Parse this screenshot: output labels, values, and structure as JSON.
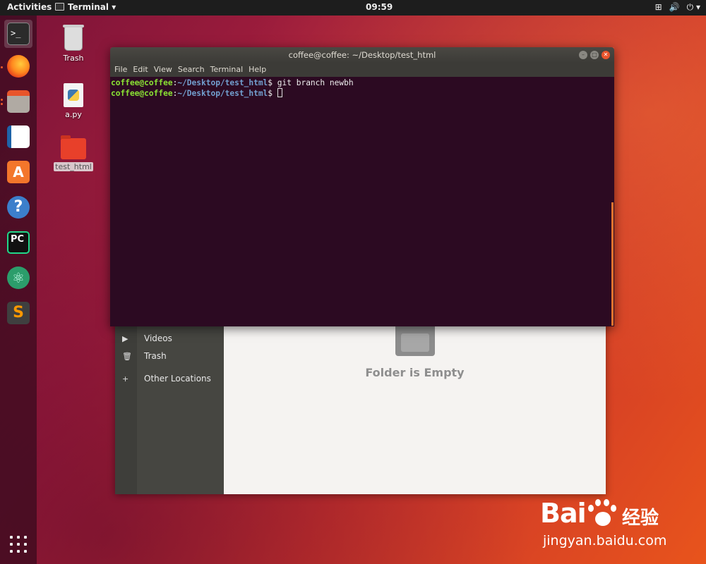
{
  "topbar": {
    "activities": "Activities",
    "app_menu": "Terminal ▾",
    "clock": "09:59",
    "tray": {
      "network": "⊞",
      "volume": "🔊",
      "power": "⏻ ▾"
    }
  },
  "dock": {
    "items": [
      {
        "name": "terminal",
        "glyph": ">_"
      },
      {
        "name": "firefox",
        "glyph": ""
      },
      {
        "name": "files",
        "glyph": ""
      },
      {
        "name": "libreoffice-writer",
        "glyph": ""
      },
      {
        "name": "ubuntu-software",
        "glyph": "A"
      },
      {
        "name": "help",
        "glyph": "?"
      },
      {
        "name": "pycharm",
        "glyph": "PC"
      },
      {
        "name": "atom",
        "glyph": "⚛"
      },
      {
        "name": "sublime-text",
        "glyph": "S"
      }
    ]
  },
  "desktop": {
    "icons": [
      {
        "label": "Trash"
      },
      {
        "label": "a.py"
      },
      {
        "label": "test_html"
      }
    ]
  },
  "files_window": {
    "sidebar": [
      {
        "icon": "video-icon",
        "glyph": "▶",
        "label": "Videos"
      },
      {
        "icon": "trash-icon",
        "glyph": "🗑",
        "label": "Trash"
      },
      {
        "icon": "plus-icon",
        "glyph": "+",
        "label": "Other Locations"
      }
    ],
    "empty_message": "Folder is Empty"
  },
  "terminal": {
    "title": "coffee@coffee: ~/Desktop/test_html",
    "menu": [
      "File",
      "Edit",
      "View",
      "Search",
      "Terminal",
      "Help"
    ],
    "lines": [
      {
        "user": "coffee@coffee",
        "sep": ":",
        "path": "~/Desktop/test_html",
        "prompt": "$ ",
        "command": "git branch newbh"
      },
      {
        "user": "coffee@coffee",
        "sep": ":",
        "path": "~/Desktop/test_html",
        "prompt": "$ ",
        "command": ""
      }
    ]
  },
  "watermark": {
    "logo": "Bai",
    "cn": "经验",
    "url": "jingyan.baidu.com"
  },
  "colors": {
    "terminal_bg": "#2c0a22",
    "prompt_user": "#8ae234",
    "prompt_path": "#729fcf",
    "accent": "#e9542c"
  }
}
